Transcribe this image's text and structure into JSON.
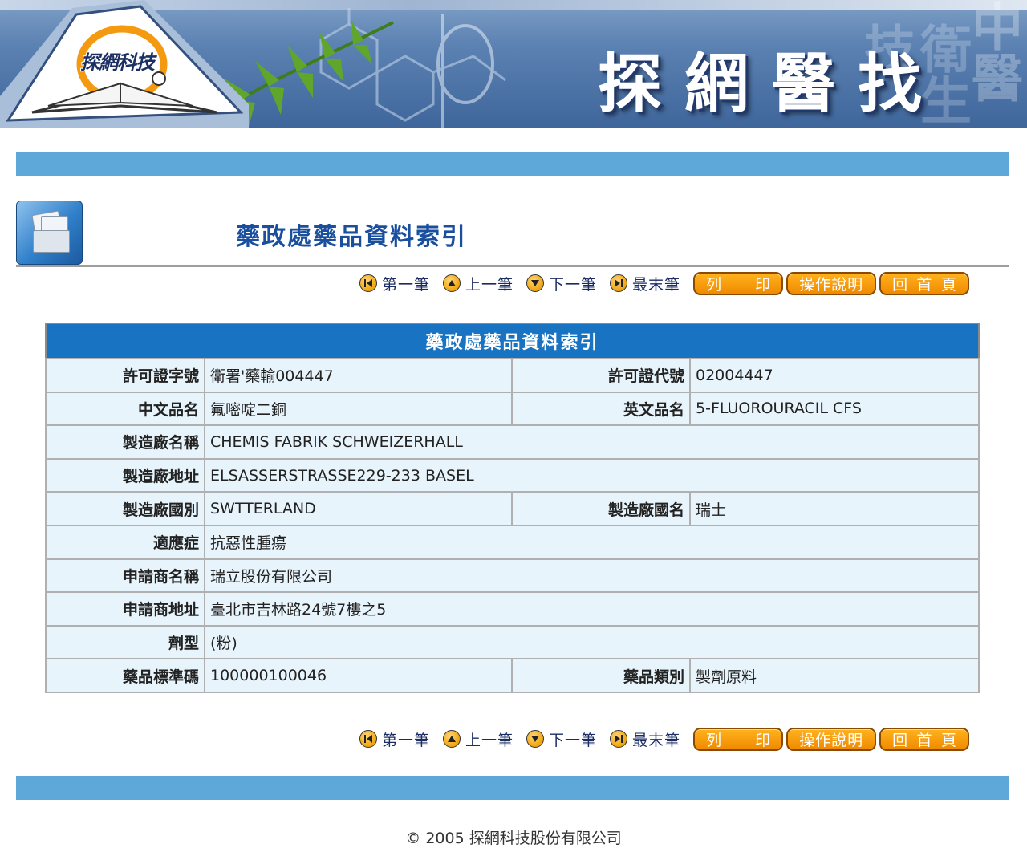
{
  "banner": {
    "logo_text": "探網科技",
    "brand_text": "探網醫找",
    "ghost_text_right": "中醫",
    "ghost_text_left": "衛生技"
  },
  "page": {
    "title": "藥政處藥品資料索引"
  },
  "nav": {
    "first": "第一筆",
    "prev": "上一筆",
    "next": "下一筆",
    "last": "最末筆",
    "print_left": "列",
    "print_right": "印",
    "help": "操作說明",
    "home_1": "回",
    "home_2": "首",
    "home_3": "頁"
  },
  "table": {
    "header": "藥政處藥品資料索引",
    "rows": [
      {
        "label": "許可證字號",
        "value": "衛署'藥輸004447",
        "label2": "許可證代號",
        "value2": "02004447"
      },
      {
        "label": "中文品名",
        "value": "氟嘧啶二銅",
        "label2": "英文品名",
        "value2": "5-FLUOROURACIL CFS"
      },
      {
        "label": "製造廠名稱",
        "value": "CHEMIS FABRIK SCHWEIZERHALL"
      },
      {
        "label": "製造廠地址",
        "value": "ELSASSERSTRASSE229-233 BASEL"
      },
      {
        "label": "製造廠國別",
        "value": "SWTTERLAND",
        "label2": "製造廠國名",
        "value2": "瑞士"
      },
      {
        "label": "適應症",
        "value": "抗惡性腫瘍"
      },
      {
        "label": "申請商名稱",
        "value": "瑞立股份有限公司"
      },
      {
        "label": "申請商地址",
        "value": "臺北市吉林路24號7樓之5"
      },
      {
        "label": "劑型",
        "value": "(粉)"
      },
      {
        "label": "藥品標準碼",
        "value": "100000100046",
        "label2": "藥品類別",
        "value2": "製劑原料"
      }
    ]
  },
  "footer": {
    "copyright": "© 2005 探網科技股份有限公司"
  },
  "colors": {
    "accent_bar": "#5da8d8",
    "table_header": "#1873c2",
    "button_orange": "#f08a00",
    "title_blue": "#1a4f9e"
  }
}
